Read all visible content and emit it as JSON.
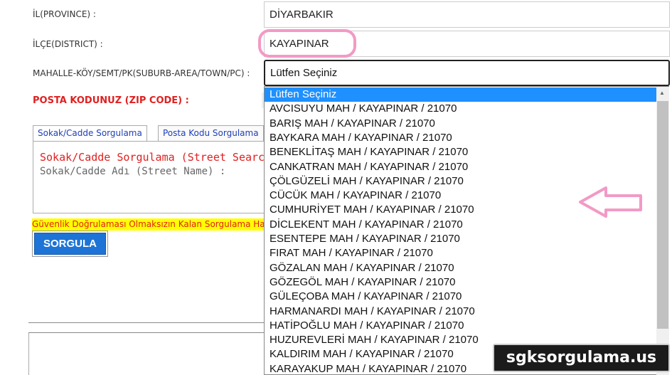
{
  "form": {
    "province_label": "İL(PROVINCE) :",
    "province_value": "DİYARBAKIR",
    "district_label": "İLÇE(DISTRICT) :",
    "district_value": "KAYAPINAR",
    "neighborhood_label": "MAHALLE-KÖY/SEMT/PK(SUBURB-AREA/TOWN/PC) :",
    "neighborhood_selected": "Lütfen Seçiniz",
    "zip_label": "POSTA KODUNUZ (ZIP CODE) :"
  },
  "tabs": [
    {
      "label": "Sokak/Cadde Sorgulama",
      "active": true
    },
    {
      "label": "Posta Kodu Sorgulama",
      "active": false
    }
  ],
  "street_search": {
    "title": "Sokak/Cadde Sorgulama (Street Search)",
    "name_label": "Sokak/Cadde Adı (Street Name) :"
  },
  "warning_text": "Güvenlik Doğrulaması Olmaksızın Kalan Sorgulama Ha",
  "query_button": "SORGULA",
  "dropdown_options": [
    "Lütfen Seçiniz",
    "AVCISUYU MAH / KAYAPINAR / 21070",
    "BARIŞ MAH / KAYAPINAR / 21070",
    "BAYKARA MAH / KAYAPINAR / 21070",
    "BENEKLİTAŞ MAH / KAYAPINAR / 21070",
    "CANKATRAN MAH / KAYAPINAR / 21070",
    "ÇÖLGÜZELİ MAH / KAYAPINAR / 21070",
    "CÜCÜK MAH / KAYAPINAR / 21070",
    "CUMHURİYET MAH / KAYAPINAR / 21070",
    "DİCLEKENT MAH / KAYAPINAR / 21070",
    "ESENTEPE MAH / KAYAPINAR / 21070",
    "FIRAT MAH / KAYAPINAR / 21070",
    "GÖZALAN MAH / KAYAPINAR / 21070",
    "GÖZEGÖL MAH / KAYAPINAR / 21070",
    "GÜLEÇOBA MAH / KAYAPINAR / 21070",
    "HARMANARDI MAH / KAYAPINAR / 21070",
    "HATİPOĞLU MAH / KAYAPINAR / 21070",
    "HUZUREVLERİ MAH / KAYAPINAR / 21070",
    "KALDIRIM MAH / KAYAPINAR / 21070",
    "KARAYAKUP MAH / KAYAPINAR / 21070"
  ],
  "watermark": "sgksorgulama.us",
  "colors": {
    "accent_red": "#e02020",
    "select_highlight": "#1e90ff",
    "button_blue": "#1e74d6",
    "annotation_pink": "#f29ac5",
    "warning_bg": "#ffff00"
  }
}
